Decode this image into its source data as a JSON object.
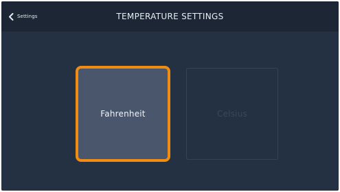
{
  "header": {
    "back_label": "Settings",
    "title": "TEMPERATURE SETTINGS"
  },
  "options": [
    {
      "label": "Fahrenheit",
      "selected": true
    },
    {
      "label": "Celsius",
      "selected": false
    }
  ],
  "colors": {
    "background": "#243142",
    "header": "#1c2635",
    "selected_fill": "#4a566b",
    "selected_border": "#f08c11",
    "unselected_border": "#36425a"
  },
  "icons": {
    "back": "chevron-left-icon"
  }
}
